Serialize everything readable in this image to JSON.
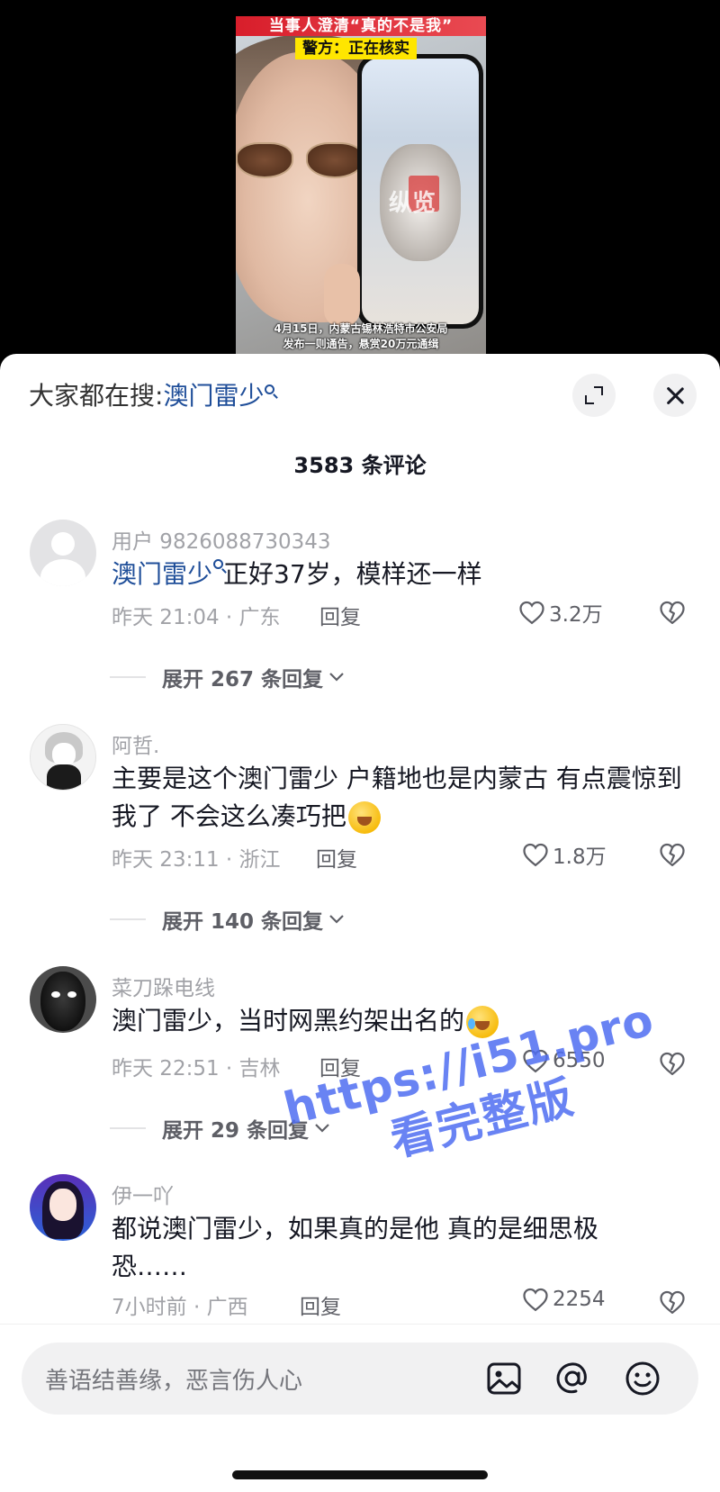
{
  "video": {
    "caption_top_1": "当事人澄清“真的不是我”",
    "caption_top_2": "警方：正在核实",
    "phone_watermark": "纵览",
    "caption_bottom_1": "4月15日，内蒙古锡林浩特市公安局",
    "caption_bottom_2": "发布一则通告，悬赏20万元通缉"
  },
  "header": {
    "hot_search_prefix": "大家都在搜:",
    "hot_search_keyword": "澳门雷少",
    "comment_count": "3583 条评论"
  },
  "comments": [
    {
      "user": "用户 9826088730343",
      "keyword": "澳门雷少",
      "text": "正好37岁，模样还一样",
      "meta": "昨天 21:04 · 广东",
      "reply_label": "回复",
      "likes": "3.2万",
      "expand": "展开 267 条回复"
    },
    {
      "user": "阿哲.",
      "text": "主要是这个澳门雷少 户籍地也是内蒙古 有点震惊到我了 不会这么凑巧把",
      "meta": "昨天 23:11 · 浙江",
      "reply_label": "回复",
      "likes": "1.8万",
      "expand": "展开 140 条回复"
    },
    {
      "user": "菜刀跺电线",
      "text": "澳门雷少，当时网黑约架出名的",
      "meta": "昨天 22:51 · 吉林",
      "reply_label": "回复",
      "likes": "6550",
      "expand": "展开 29 条回复"
    },
    {
      "user": "伊一吖",
      "text": "都说澳门雷少，如果真的是他 真的是细思极恐……",
      "meta": "7小时前 · 广西",
      "reply_label": "回复",
      "likes": "2254"
    }
  ],
  "watermark": {
    "line1": "https://i51.pro",
    "line2": "看完整版"
  },
  "input": {
    "placeholder": "善语结善缘，恶言伤人心"
  },
  "icons": [
    "expand-icon",
    "close-icon",
    "heart-icon",
    "dislike-icon",
    "chevron-down-icon",
    "image-icon",
    "at-icon",
    "emoji-icon"
  ],
  "colors": {
    "keyword_blue": "#1f4e99",
    "watermark_blue": "#4f6ef2",
    "gray_text": "#a1a2a7"
  }
}
